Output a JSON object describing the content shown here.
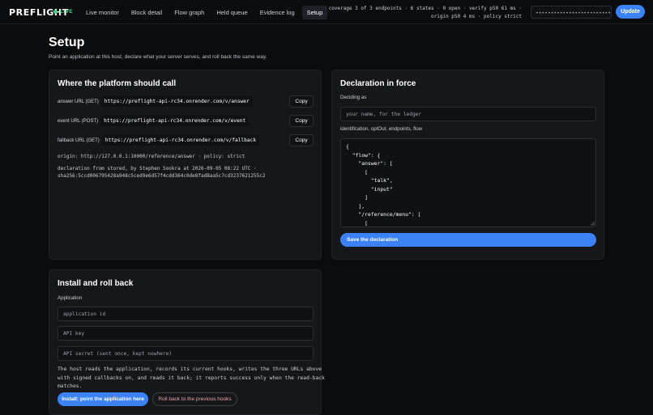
{
  "header": {
    "brand": "PREFLIGHT",
    "live_label": "LIVE",
    "nav": [
      "Live monitor",
      "Block detail",
      "Flow graph",
      "Held queue",
      "Evidence log",
      "Setup"
    ],
    "status_line1": "coverage 3 of 3 endpoints · 6 states · 0 open · verify p50 61 ms ·",
    "status_line2": "origin p50 4 ms · policy strict",
    "token_value": "••••••••••••••••••••••••••••••",
    "update_label": "Update"
  },
  "page": {
    "title": "Setup",
    "subtitle": "Point an application at this host, declare what your server serves, and roll back the same way."
  },
  "platform": {
    "title": "Where the platform should call",
    "urls": [
      {
        "label": "answer URL (GET)",
        "value": "https://preflight-api-rc34.onrender.com/v/answer"
      },
      {
        "label": "event URL (POST)",
        "value": "https://preflight-api-rc34.onrender.com/v/event"
      },
      {
        "label": "fallback URL (GET)",
        "value": "https://preflight-api-rc34.onrender.com/v/fallback"
      }
    ],
    "copy_label": "Copy",
    "origin_line": "origin: http://127.0.0.1:10000/reference/answer · policy: strict",
    "declaration_line1": "declaration from stored, by Stephen Sookra at 2026-09-05 08:22 UTC ·",
    "declaration_line2": "sha256:5ccd006795428a948c5ced9e6d57f4cdd364c0de8fad8aa5c7cd3237621255c2"
  },
  "declaration": {
    "title": "Declaration in force",
    "deciding_label": "Deciding as",
    "deciding_placeholder": "your name, for the ledger",
    "json_label": "identification, optOut, endpoints, flow",
    "json_text": "{\n  \"flow\": {\n    \"answer\": [\n      [\n        \"talk\",\n        \"input\"\n      ]\n    ],\n    \"/reference/menu\": [\n      [\n        \"connect\"\n      ]",
    "save_label": "Save the declaration"
  },
  "install": {
    "title": "Install and roll back",
    "app_label": "Application",
    "app_id_placeholder": "application id",
    "api_key_placeholder": "API key",
    "api_secret_placeholder": "API secret (sent once, kept nowhere)",
    "description": "The host reads the application, records its current hooks, writes the three URLs above\nwith signed callbacks on, and reads it back; it reports success only when the read-back\nmatches.",
    "install_label": "Install: point the application here",
    "rollback_label": "Roll back to the previous hooks"
  }
}
